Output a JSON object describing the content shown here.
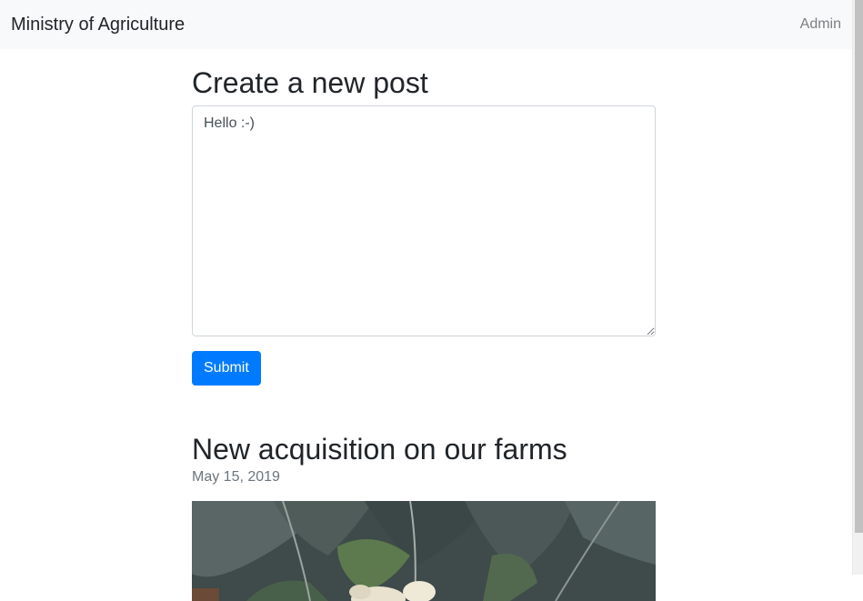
{
  "navbar": {
    "brand": "Ministry of Agriculture",
    "admin_link": "Admin"
  },
  "create_post": {
    "title": "Create a new post",
    "textarea_value": "Hello :-)",
    "submit_label": "Submit"
  },
  "post": {
    "title": "New acquisition on our farms",
    "date": "May 15, 2019"
  },
  "colors": {
    "navbar_bg": "#f8f9fa",
    "primary": "#007bff",
    "muted_text": "#6c757d"
  }
}
